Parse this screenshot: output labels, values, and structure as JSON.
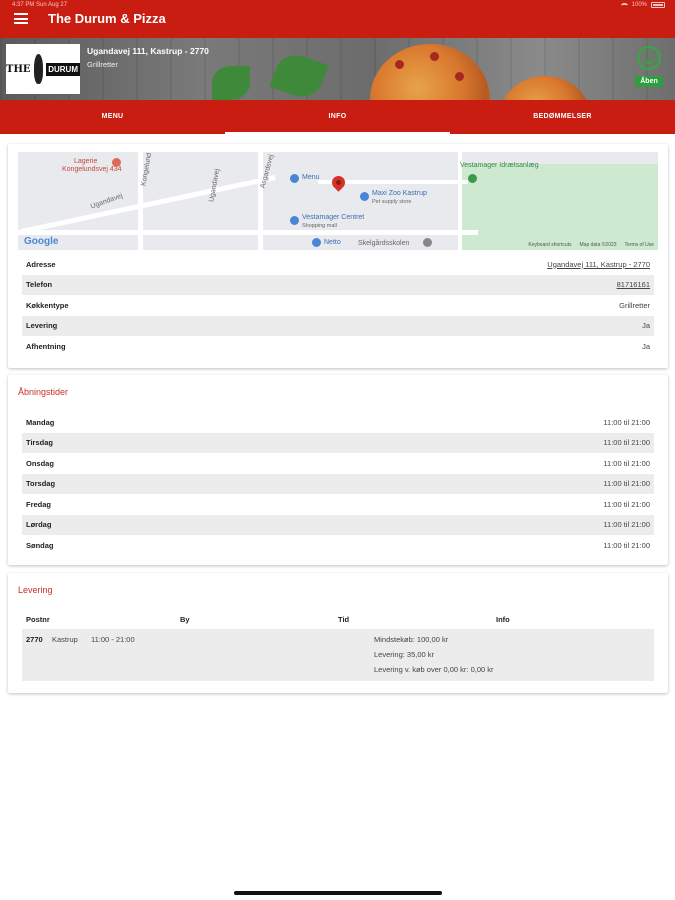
{
  "status_bar": {
    "time": "4:37 PM   Sun Aug 27",
    "battery": "100%"
  },
  "app": {
    "title": "The Durum & Pizza"
  },
  "banner": {
    "logo_left": "THE",
    "logo_right": "DURUM",
    "address": "Ugandavej 111, Kastrup - 2770",
    "cuisine": "Grillretter",
    "open_status": "Åben"
  },
  "tabs": [
    {
      "label": "MENU",
      "active": false
    },
    {
      "label": "INFO",
      "active": true
    },
    {
      "label": "BEDØMMELSER",
      "active": false
    }
  ],
  "map": {
    "labels": {
      "lagerie": "Lagerie",
      "kongelund": "Kongelundsvej 434",
      "mens": "Menu",
      "maxi": "Maxi Zoo Kastrup",
      "maxi_sub": "Pet supply store",
      "vestamager": "Vestamager Centret",
      "vestamager_sub": "Shopping mall",
      "netto": "Netto",
      "idraet": "Vestamager Idrætsanlæg",
      "skole": "Skelgårdsskolen",
      "road1": "Ugandavej",
      "road2": "Kongelund",
      "road3": "Asgardsvej",
      "road4": "Ugandavej"
    },
    "google": "Google",
    "credits": [
      "Keyboard shortcuts",
      "Map data ©2023",
      "Terms of Use"
    ]
  },
  "info": {
    "rows": [
      {
        "key": "Adresse",
        "value": "Ugandavej 111, Kastrup - 2770",
        "link": true
      },
      {
        "key": "Telefon",
        "value": "81716161",
        "link": true
      },
      {
        "key": "Køkkentype",
        "value": "Grillretter",
        "link": false
      },
      {
        "key": "Levering",
        "value": "Ja",
        "link": false
      },
      {
        "key": "Afhentning",
        "value": "Ja",
        "link": false
      }
    ]
  },
  "hours": {
    "title": "Åbningstider",
    "days": [
      {
        "day": "Mandag",
        "time": "11:00 til 21:00"
      },
      {
        "day": "Tirsdag",
        "time": "11:00 til 21:00"
      },
      {
        "day": "Onsdag",
        "time": "11:00 til 21:00"
      },
      {
        "day": "Torsdag",
        "time": "11:00 til 21:00"
      },
      {
        "day": "Fredag",
        "time": "11:00 til 21:00"
      },
      {
        "day": "Lørdag",
        "time": "11:00 til 21:00"
      },
      {
        "day": "Søndag",
        "time": "11:00 til 21:00"
      }
    ]
  },
  "delivery": {
    "title": "Levering",
    "headers": {
      "postnr": "Postnr",
      "by": "By",
      "tid": "Tid",
      "info": "Info"
    },
    "row": {
      "postnr": "2770",
      "by": "Kastrup",
      "tid": "11:00 - 21:00",
      "info1": "Mindstekøb: 100,00 kr",
      "info2": "Levering: 35,00 kr",
      "info3": "Levering v. køb over 0,00 kr: 0,00 kr"
    }
  },
  "colors": {
    "primary": "#c91d12",
    "open_green": "#2f9e3f",
    "section_title": "#c9302a"
  }
}
